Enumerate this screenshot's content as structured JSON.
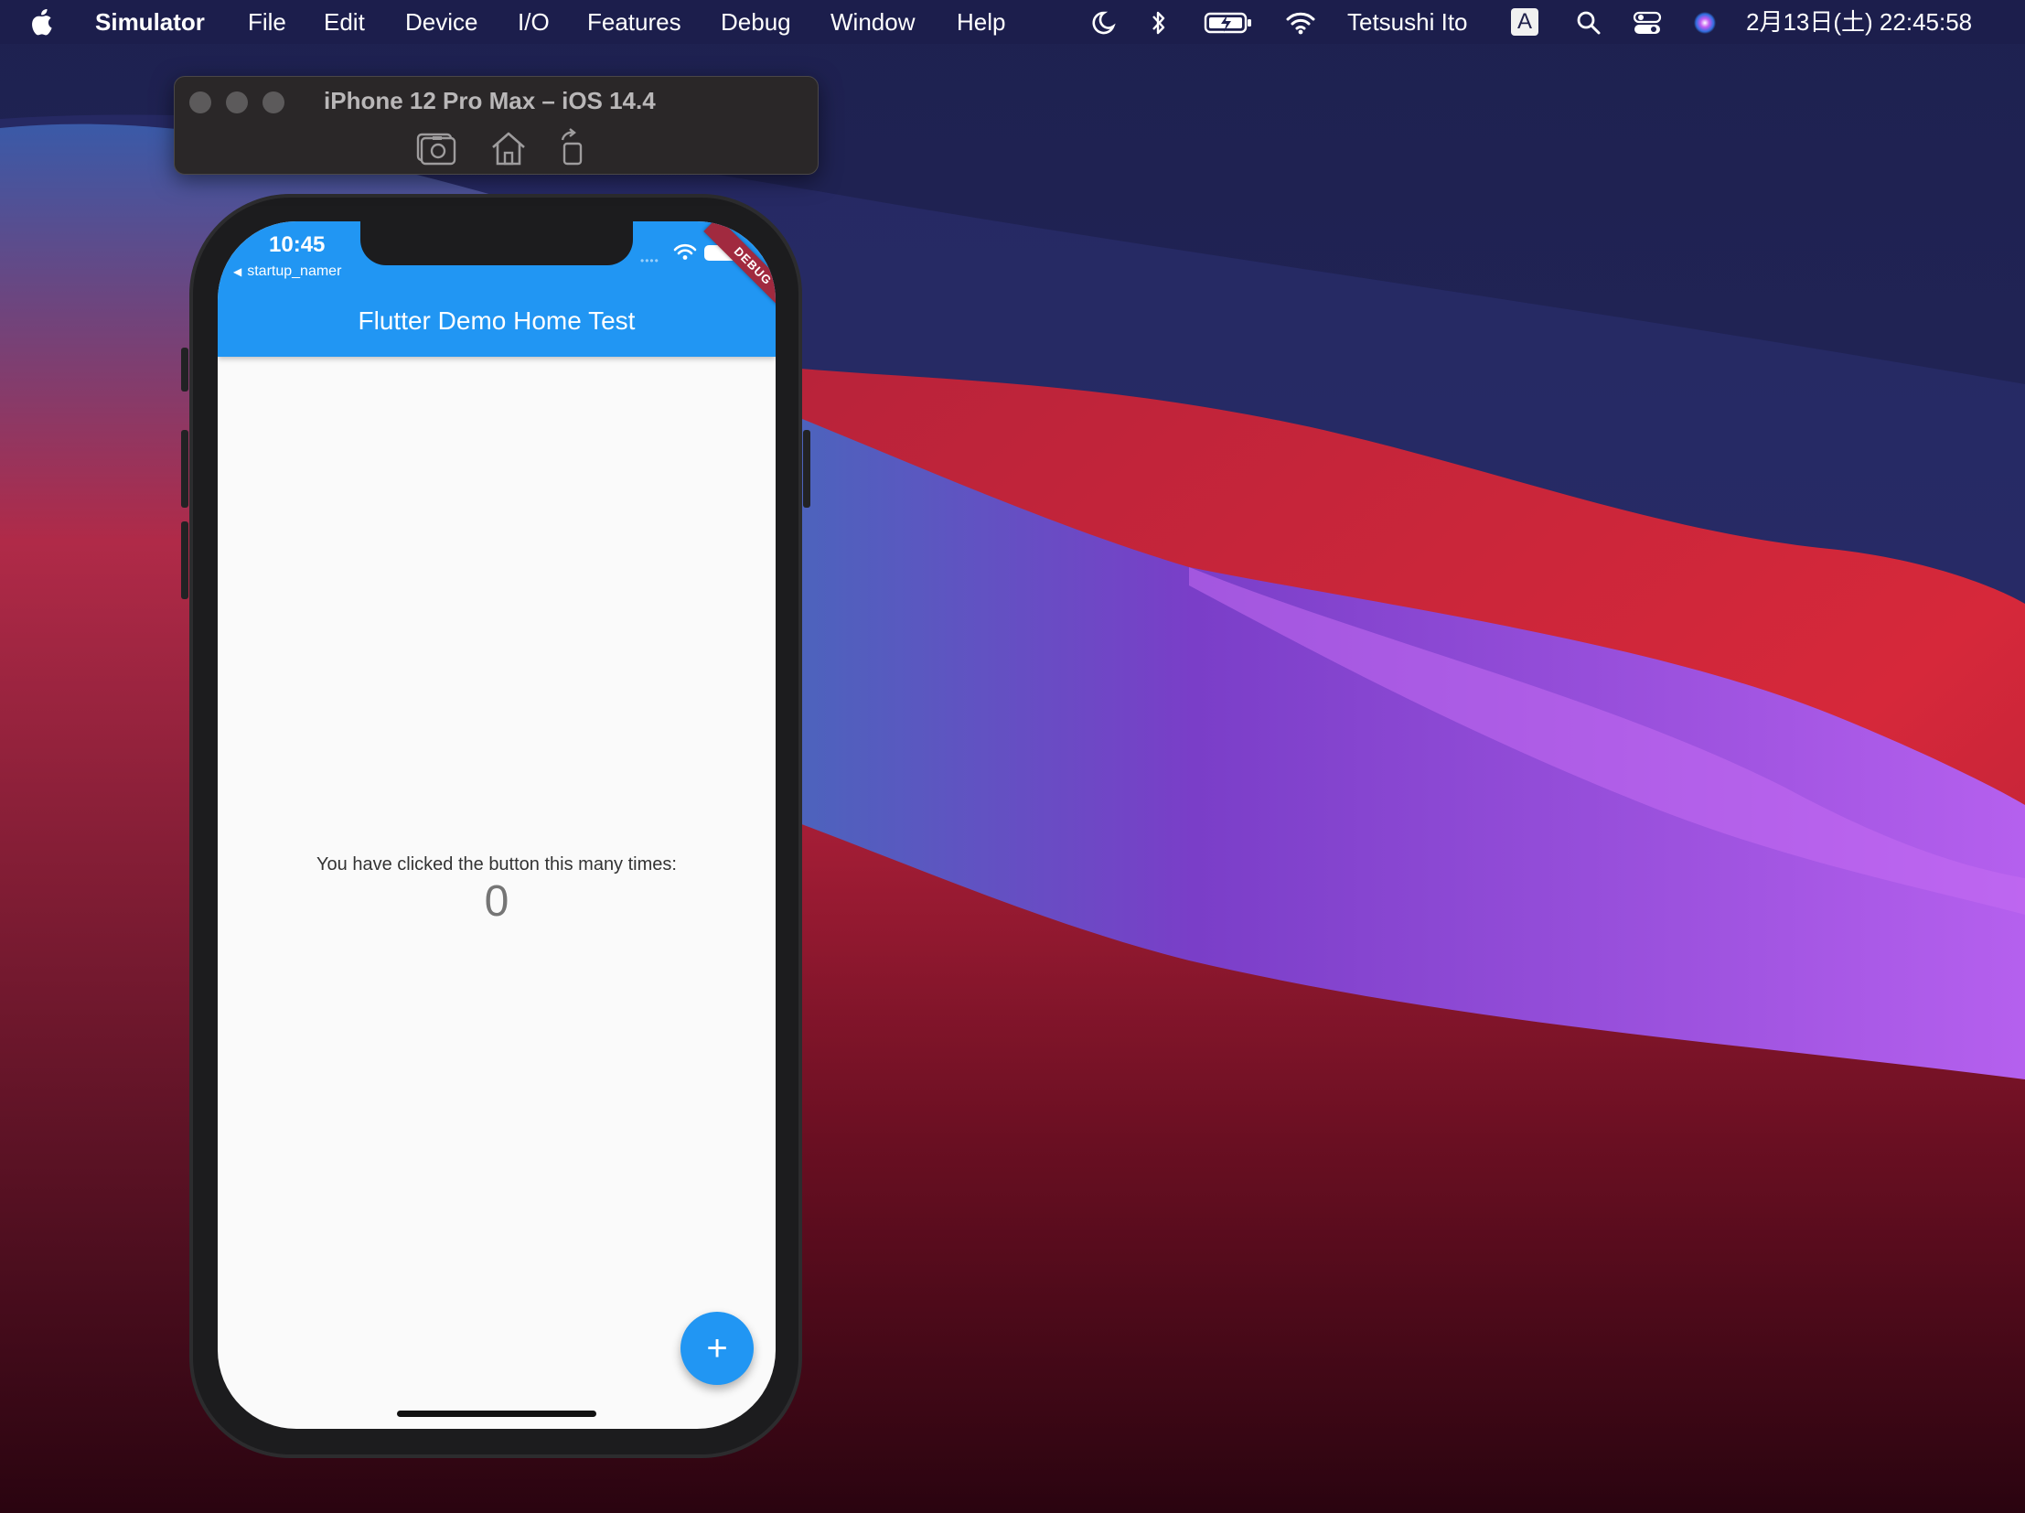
{
  "menubar": {
    "app_name": "Simulator",
    "items": [
      "File",
      "Edit",
      "Device",
      "I/O",
      "Features",
      "Debug",
      "Window",
      "Help"
    ],
    "user": "Tetsushi Ito",
    "input_source": "A",
    "datetime": "2月13日(土)  22:45:58"
  },
  "simulator": {
    "title": "iPhone 12 Pro Max – iOS 14.4"
  },
  "phone": {
    "status_time": "10:45",
    "back_label": "startup_namer",
    "debug_banner": "DEBUG",
    "app_title": "Flutter Demo Home Test",
    "counter_label": "You have clicked the button this many times:",
    "counter_value": "0",
    "fab_icon": "+"
  },
  "colors": {
    "app_primary": "#2196f3",
    "debug_banner": "#a12a3f",
    "screen_background": "#fafafa"
  },
  "icons": [
    "apple-logo",
    "moon",
    "bluetooth",
    "battery-charging",
    "wifi",
    "spotlight-search",
    "control-center",
    "siri",
    "screenshot",
    "home",
    "rotate"
  ]
}
